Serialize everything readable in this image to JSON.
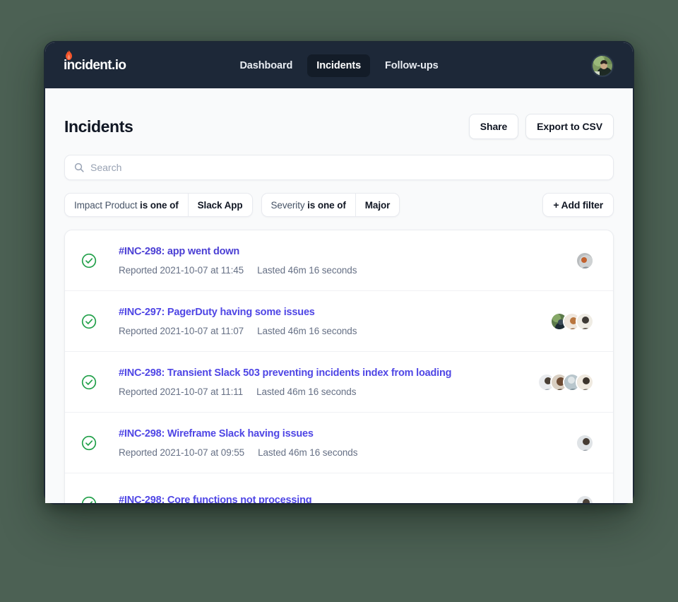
{
  "brand": {
    "wordmark": "incident.io",
    "flame_color": "#f4552a"
  },
  "nav": {
    "items": [
      {
        "label": "Dashboard",
        "active": false
      },
      {
        "label": "Incidents",
        "active": true
      },
      {
        "label": "Follow-ups",
        "active": false
      }
    ],
    "avatar": "user-avatar"
  },
  "header": {
    "title": "Incidents",
    "share_label": "Share",
    "export_label": "Export to CSV"
  },
  "search": {
    "placeholder": "Search",
    "value": "",
    "icon": "search-icon"
  },
  "filters": {
    "chips": [
      {
        "field": "Impact Product",
        "operator": "is one of",
        "value": "Slack App"
      },
      {
        "field": "Severity",
        "operator": "is one of",
        "value": "Major"
      }
    ],
    "add_label": "+ Add filter"
  },
  "incidents": [
    {
      "status": "resolved",
      "title": "#INC-298: app went down",
      "reported": "Reported 2021-10-07 at 11:45",
      "lasted": "Lasted 46m 16 seconds",
      "responders": 1
    },
    {
      "status": "resolved",
      "title": "#INC-297: PagerDuty having some issues",
      "reported": "Reported 2021-10-07 at 11:07",
      "lasted": "Lasted 46m 16 seconds",
      "responders": 3
    },
    {
      "status": "resolved",
      "title": "#INC-298: Transient Slack 503 preventing incidents index from loading",
      "reported": "Reported 2021-10-07 at 11:11",
      "lasted": "Lasted 46m 16 seconds",
      "responders": 4
    },
    {
      "status": "resolved",
      "title": "#INC-298: Wireframe Slack having issues",
      "reported": "Reported 2021-10-07 at 09:55",
      "lasted": "Lasted 46m 16 seconds",
      "responders": 1
    },
    {
      "status": "resolved",
      "title": "#INC-298: Core functions not processing",
      "reported": "",
      "lasted": "",
      "responders": 1
    }
  ],
  "colors": {
    "page_background": "#4c6154",
    "nav_background": "#1d2838",
    "nav_active": "#131c28",
    "status_green": "#22a04a",
    "link_purple": "#4b3fd4",
    "body_background": "#f9fafb"
  }
}
